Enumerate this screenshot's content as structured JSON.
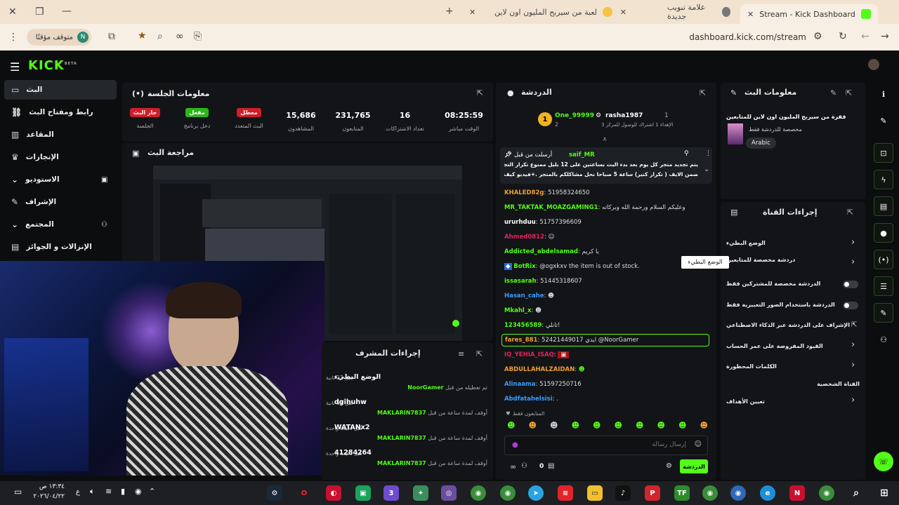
{
  "browser": {
    "tabs": [
      {
        "title": "Stream - Kick Dashboard",
        "active": true
      },
      {
        "title": "علامة تبويب جديدة",
        "active": false
      },
      {
        "title": "لعبة من سيربح المليون اون لاين",
        "active": false
      }
    ],
    "profile_status": "متوقف مؤقتًا",
    "profile_initial": "N",
    "url": "dashboard.kick.com/stream"
  },
  "kick": {
    "logo": "KICK",
    "logo_badge": "BETA"
  },
  "sidebar": {
    "items": [
      {
        "label": "البث",
        "icon": "broadcast-icon"
      },
      {
        "label": "رابط ومفتاح البث",
        "icon": "link-icon"
      },
      {
        "label": "المقاعد",
        "icon": "chart-icon"
      },
      {
        "label": "الإنجازات",
        "icon": "trophy-icon"
      },
      {
        "label": "الاستوديو",
        "icon": "studio-icon"
      },
      {
        "label": "الإشراف",
        "icon": "wrench-icon"
      },
      {
        "label": "المجتمع",
        "icon": "community-icon"
      },
      {
        "label": "الإنزالات و الجوائز",
        "icon": "gift-icon"
      }
    ]
  },
  "session": {
    "title": "معلومات الجلسة",
    "stats": [
      {
        "label": "الوقت مباشر",
        "value": "08:25:59"
      },
      {
        "label": "تعداد الاشتراكات",
        "value": "16"
      },
      {
        "label": "المتابعون",
        "value": "231,765"
      },
      {
        "label": "المشاهدون",
        "value": "15,686"
      },
      {
        "label": "البث المتعدد",
        "badge": "معطل",
        "badge_color": "#d11d2a"
      },
      {
        "label": "دخل برنامج",
        "badge": "مفعل",
        "badge_color": "#2db51b"
      },
      {
        "label": "الجلسة",
        "badge": "جار البث",
        "badge_color": "#d11d2a"
      }
    ]
  },
  "preview": {
    "title": "مراجعة البث"
  },
  "mod_actions": {
    "title": "إجراءات المشرف",
    "items": [
      {
        "title": "الوضع البطيء",
        "sub": "تم تعطيله من قبل",
        "user": "NoorGamer",
        "time": "قبل 27 ثانية"
      },
      {
        "title": "dgihuhw",
        "sub": "أوقف لمدة ساعة من قبل",
        "user": "MAKLARIN7837",
        "time": "قبل 51 ثانية"
      },
      {
        "title": "WATANx2",
        "sub": "أوقف لمدة ساعة من قبل",
        "user": "MAKLARIN7837",
        "time": "قبل دقيقة واحدة"
      },
      {
        "title": "41284264",
        "sub": "أوقف لمدة ساعة من قبل",
        "user": "MAKLARIN7837",
        "time": "قبل دقيقة واحدة"
      }
    ]
  },
  "chat": {
    "title": "الدردشة",
    "top_gifters": [
      {
        "rank": "1",
        "name": "rasha1987",
        "sub": "الإهداء 1 اشتراك للوصول للمركز 3"
      },
      {
        "rank": "2",
        "name": "One_99999"
      }
    ],
    "pinned": {
      "user": "saif_MR",
      "label": "أرسلت من قبل",
      "text_line1": "يتم تجديد متجر كل يوم بعد بدء البث بساعتين على 12 بليل ممنوع تكرار التجديد",
      "text_line2": "ضمن الايف ( تكرار كتير) ساعة 5 صباحا نحل مشاكلكم بالمتجر .+فيديو كيف تربح"
    },
    "messages": [
      {
        "user": "KHALED82g",
        "color": "#f0a030",
        "text": "51958324650"
      },
      {
        "user": "MR_TAKTAK_MOAZGAMING1",
        "color": "#53fc18",
        "text": "وعليكم السلام ورحمة الله وبركاته"
      },
      {
        "user": "ururhduu",
        "color": "#ffffff",
        "text": "51757396609"
      },
      {
        "user": "Ahmed0812",
        "color": "#e0245e",
        "text": ""
      },
      {
        "user": "Addicted_abdelsamad",
        "color": "#53fc18",
        "text": "يا كريم"
      },
      {
        "user": "BotRix",
        "color": "#53fc18",
        "text": "@ogxkxv the item is out of stock."
      },
      {
        "user": "issasarah",
        "color": "#53fc18",
        "text": "51445318607"
      },
      {
        "user": "Hasan_cahe",
        "color": "#3b9cff",
        "text": ""
      },
      {
        "user": "Mkahl_x",
        "color": "#53fc18",
        "text": ""
      },
      {
        "user": "123456589",
        "color": "#53fc18",
        "text": "ثانلي!"
      },
      {
        "user": "fares_881",
        "color": "#f0a030",
        "text": "52421449017 ايدي @NoorGamer"
      },
      {
        "user": "IQ_YEHIA_ISAQ",
        "color": "#e0245e",
        "text": ""
      },
      {
        "user": "ABDULLAHALZAIDAN",
        "color": "#f0a030",
        "text": ""
      },
      {
        "user": "Alinaama",
        "color": "#3b9cff",
        "text": "51597250716"
      },
      {
        "user": "Abdfatahelsisi",
        "color": "#3b9cff",
        "text": "."
      }
    ],
    "followers_only": "المتابعون فقط",
    "input_placeholder": "إرسال رسالة",
    "send_label": "الدردشة",
    "counter": "0"
  },
  "stream_info": {
    "title": "معلومات البث",
    "stream_title": "فقرة من سيربح المليون اون لاين للمتابعين",
    "category": "مخصصة للدردشة فقط",
    "language": "Arabic"
  },
  "channel_actions": {
    "title": "إجراءات القناة",
    "items": [
      {
        "label": "الوضع البطيء",
        "type": "chevron"
      },
      {
        "label": "دردشة مخصصة للمتابعين",
        "type": "chevron"
      },
      {
        "label": "الدردشة مخصصة للمشتركين فقط",
        "type": "toggle"
      },
      {
        "label": "الدردشة باستخدام الصور التعبيرية فقط",
        "type": "toggle"
      },
      {
        "label": "الإشراف على الدردشة عبر الذكاء الاصطناعي",
        "type": "external"
      },
      {
        "label": "القيود المفروضة على عمر الحساب",
        "type": "chevron"
      },
      {
        "label": "الكلمات المحظورة",
        "type": "chevron"
      }
    ],
    "section_label": "القناة الشخصية",
    "goals_label": "تعيين الأهداف",
    "tooltip": "الوضع البطيء"
  },
  "taskbar": {
    "time": "١٣:٣٤ ص",
    "date": "٢٠٢٦/٠٤/٢٢",
    "lang": "ع"
  }
}
